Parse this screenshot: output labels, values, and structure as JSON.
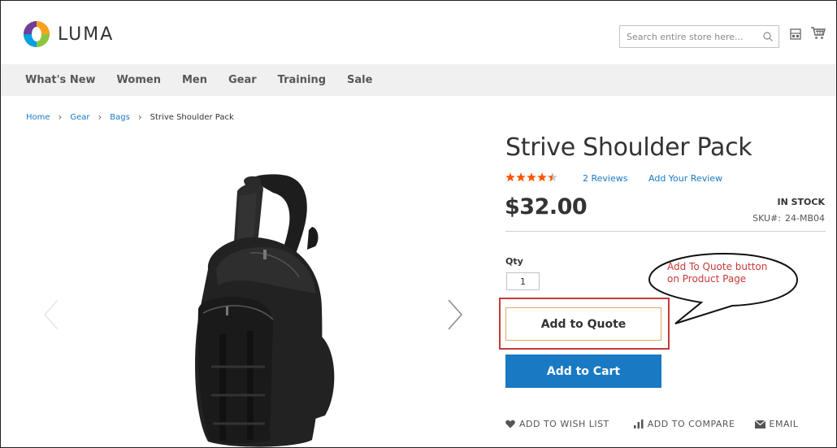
{
  "header": {
    "logo_text": "LUMA",
    "search_placeholder": "Search entire store here...",
    "icons": [
      "search-icon",
      "compare-icon",
      "cart-icon"
    ]
  },
  "nav": {
    "items": [
      "What's New",
      "Women",
      "Men",
      "Gear",
      "Training",
      "Sale"
    ]
  },
  "breadcrumb": {
    "links": [
      "Home",
      "Gear",
      "Bags"
    ],
    "current": "Strive Shoulder Pack"
  },
  "product": {
    "title": "Strive Shoulder Pack",
    "rating_fraction": 0.9,
    "reviews_link": "2  Reviews",
    "add_review_link": "Add Your Review",
    "price": "$32.00",
    "stock": "IN STOCK",
    "sku_label": "SKU#:",
    "sku_value": "24-MB04",
    "qty_label": "Qty",
    "qty_value": "1",
    "add_to_quote_label": "Add to Quote",
    "add_to_cart_label": "Add to Cart"
  },
  "callout": {
    "line1": "Add To Quote button",
    "line2": "on Product Page"
  },
  "actions": {
    "wish_list": "ADD TO WISH LIST",
    "compare": "ADD TO COMPARE",
    "email": "EMAIL"
  },
  "colors": {
    "accent_blue": "#1979c3",
    "nav_bg": "#f0f0f0",
    "star_orange": "#ff5501",
    "highlight_red": "#c73a3a",
    "quote_border": "#e9a36c"
  }
}
